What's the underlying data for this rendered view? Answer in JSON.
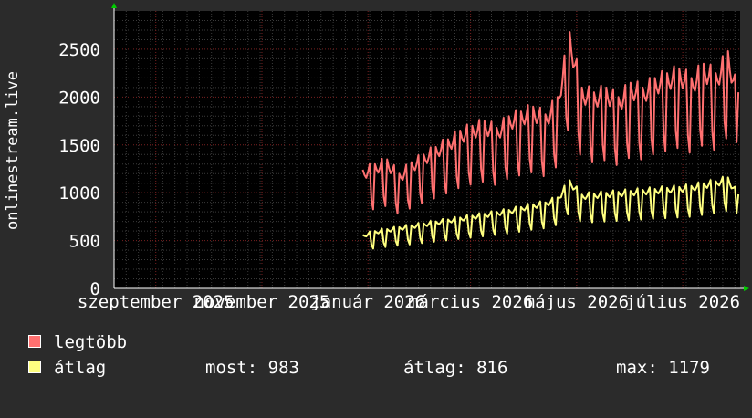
{
  "chart_data": {
    "type": "line",
    "ylabel": "onlinestream.live",
    "ylim": [
      0,
      2900
    ],
    "y_ticks": [
      0,
      500,
      1000,
      1500,
      2000,
      2500
    ],
    "x_tick_labels": [
      "szeptember 2025",
      "november 2025",
      "január 2026",
      "március 2026",
      "május 2026",
      "július 2026"
    ],
    "x_tick_dates": [
      "2025-09-01",
      "2025-11-01",
      "2026-01-01",
      "2026-03-01",
      "2026-05-01",
      "2026-07-01"
    ],
    "x_range": [
      "2025-08-08",
      "2026-08-03"
    ],
    "series": [
      {
        "name": "legtöbb",
        "color": "#ff7070",
        "x": [
          "2025-12-29",
          "2026-01-05",
          "2026-01-12",
          "2026-01-19",
          "2026-01-26",
          "2026-02-02",
          "2026-02-09",
          "2026-02-16",
          "2026-02-23",
          "2026-03-02",
          "2026-03-09",
          "2026-03-16",
          "2026-03-23",
          "2026-03-30",
          "2026-04-06",
          "2026-04-13",
          "2026-04-20",
          "2026-04-27",
          "2026-05-04",
          "2026-05-11",
          "2026-05-18",
          "2026-05-25",
          "2026-06-01",
          "2026-06-08",
          "2026-06-15",
          "2026-06-22",
          "2026-06-29",
          "2026-07-06",
          "2026-07-13",
          "2026-07-20",
          "2026-07-27",
          "2026-08-02"
        ],
        "values": [
          1240,
          1300,
          1350,
          1200,
          1320,
          1400,
          1480,
          1560,
          1650,
          1700,
          1750,
          1680,
          1800,
          1850,
          1900,
          1820,
          2000,
          2680,
          2100,
          2050,
          2100,
          2000,
          2150,
          2100,
          2200,
          2250,
          2300,
          2200,
          2350,
          2250,
          2480,
          2050
        ]
      },
      {
        "name": "átlag",
        "color": "#ffff80",
        "x": [
          "2025-12-29",
          "2026-01-05",
          "2026-01-12",
          "2026-01-19",
          "2026-01-26",
          "2026-02-02",
          "2026-02-09",
          "2026-02-16",
          "2026-02-23",
          "2026-03-02",
          "2026-03-09",
          "2026-03-16",
          "2026-03-23",
          "2026-03-30",
          "2026-04-06",
          "2026-04-13",
          "2026-04-20",
          "2026-04-27",
          "2026-05-04",
          "2026-05-11",
          "2026-05-18",
          "2026-05-25",
          "2026-06-01",
          "2026-06-08",
          "2026-06-15",
          "2026-06-22",
          "2026-06-29",
          "2026-07-06",
          "2026-07-13",
          "2026-07-20",
          "2026-07-27",
          "2026-08-02"
        ],
        "values": [
          560,
          600,
          620,
          640,
          660,
          680,
          700,
          720,
          740,
          760,
          780,
          800,
          820,
          850,
          880,
          900,
          950,
          1130,
          980,
          990,
          1000,
          1010,
          1020,
          1030,
          1040,
          1050,
          1060,
          1070,
          1100,
          1120,
          1160,
          983
        ]
      }
    ],
    "grid": true,
    "legend_position": "bottom-left"
  },
  "legend": [
    {
      "label": "legtöbb",
      "color": "#ff7070"
    },
    {
      "label": "átlag",
      "color": "#ffff80"
    }
  ],
  "stats": {
    "now": "most: 983",
    "avg": "átlag: 816",
    "max": "max: 1179"
  }
}
